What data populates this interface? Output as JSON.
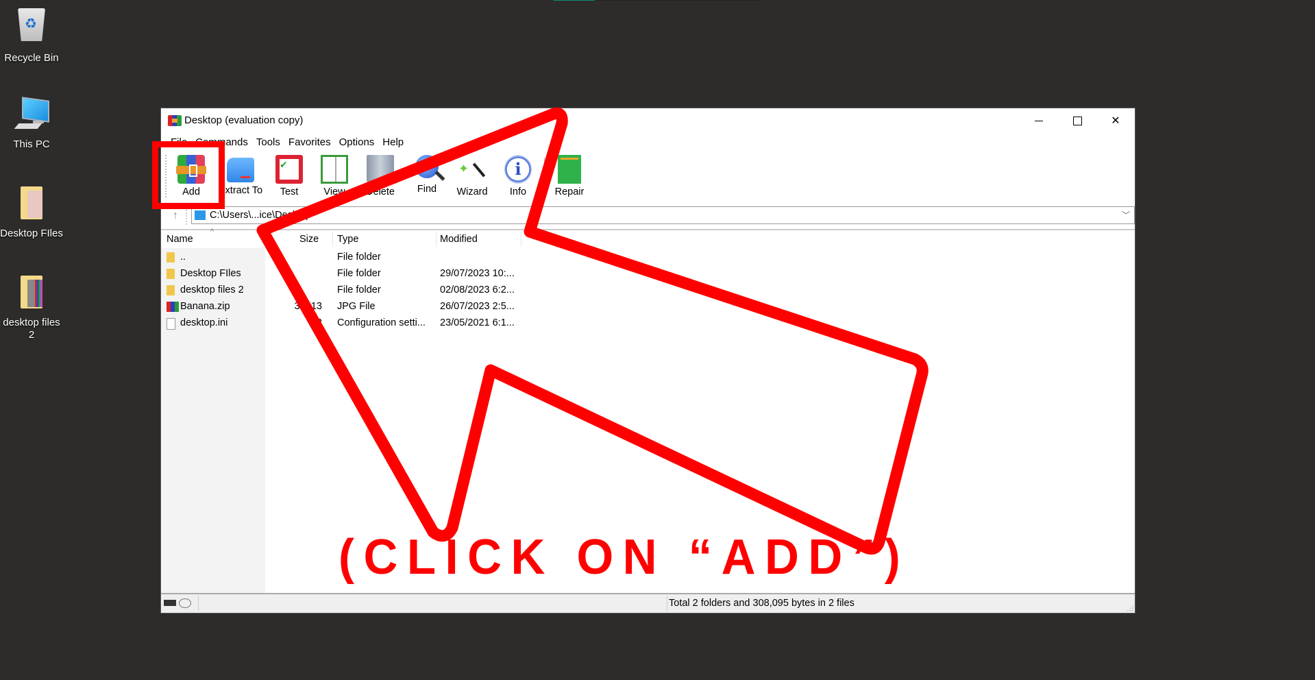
{
  "desktop": {
    "icons": [
      {
        "name": "Recycle Bin"
      },
      {
        "name": "This PC"
      },
      {
        "name": "Desktop FIles"
      },
      {
        "name": "desktop files 2"
      }
    ]
  },
  "window": {
    "title": "Desktop (evaluation copy)",
    "menu": [
      "File",
      "Commands",
      "Tools",
      "Favorites",
      "Options",
      "Help"
    ],
    "toolbar": [
      {
        "label": "Add",
        "icon": "archive-books-icon"
      },
      {
        "label": "Extract To",
        "icon": "folder-extract-icon"
      },
      {
        "label": "Test",
        "icon": "clipboard-check-icon"
      },
      {
        "label": "View",
        "icon": "open-book-icon"
      },
      {
        "label": "Delete",
        "icon": "trash-icon"
      },
      {
        "label": "Find",
        "icon": "magnifier-icon"
      },
      {
        "label": "Wizard",
        "icon": "magic-wand-icon"
      },
      {
        "label": "Info",
        "icon": "info-icon"
      },
      {
        "label": "Repair",
        "icon": "first-aid-icon"
      }
    ],
    "address": {
      "path": "C:\\Users\\...ice\\Desktop"
    },
    "columns": {
      "name": "Name",
      "size": "Size",
      "type": "Type",
      "modified": "Modified"
    },
    "files": [
      {
        "name": "..",
        "size": "",
        "type": "File folder",
        "modified": "",
        "icon": "folder"
      },
      {
        "name": "Desktop FIles",
        "size": "",
        "type": "File folder",
        "modified": "29/07/2023 10:...",
        "icon": "folder"
      },
      {
        "name": "desktop files 2",
        "size": "",
        "type": "File folder",
        "modified": "02/08/2023 6:2...",
        "icon": "folder"
      },
      {
        "name": "Banana.zip",
        "size": "30..13",
        "type": "JPG File",
        "modified": "26/07/2023 2:5...",
        "icon": "rar"
      },
      {
        "name": "desktop.ini",
        "size": "2",
        "type": "Configuration setti...",
        "modified": "23/05/2021 6:1...",
        "icon": "ini"
      }
    ],
    "status": "Total 2 folders and 308,095 bytes in 2 files"
  },
  "annotation": {
    "text": "(CLICK ON “ADD”)",
    "color": "#ff0000"
  }
}
